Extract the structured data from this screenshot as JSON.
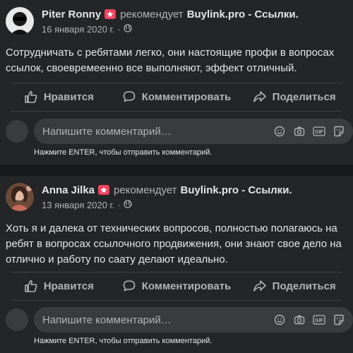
{
  "posts": [
    {
      "author": "Piter Ronny",
      "recommends": "рекомендует",
      "page": "Buylink.pro - Ссылки",
      "page_suffix": ".",
      "date": "16 января 2020 г.",
      "text": "Сотрудничать с ребятами легко, они настоящие профи в вопросах ссылок, своевремеенно все выполняют, эффект отличный."
    },
    {
      "author": "Anna Jilka",
      "recommends": "рекомендует",
      "page": "Buylink.pro - Ссылки",
      "page_suffix": ".",
      "date": "13 января 2020 г.",
      "text": "Хоть я и далека от технических вопросов, полностью полагаюсь на ребят в вопросах ссылочного продвижения, они знают свое дело на отлично и работу по саату делают идеально."
    }
  ],
  "actions": {
    "like": "Нравится",
    "comment": "Комментировать",
    "share": "Поделиться"
  },
  "comment": {
    "placeholder": "Напишите комментарий…",
    "hint": "Нажмите ENTER, чтобы отправить комментарий."
  },
  "separator_dot": "·",
  "icons": [
    "recommend-star-icon",
    "globe-icon",
    "like-icon",
    "comment-icon",
    "share-icon",
    "emoji-icon",
    "camera-icon",
    "gif-icon",
    "sticker-icon"
  ],
  "colors": {
    "background": "#18191a",
    "card": "#242526",
    "star_badge": "#f3425f",
    "input": "#3a3b3c"
  }
}
